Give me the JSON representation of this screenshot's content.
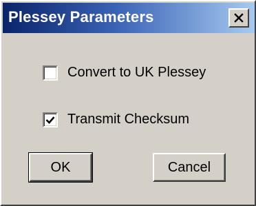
{
  "window": {
    "title": "Plessey Parameters",
    "close_icon": "close-icon"
  },
  "options": [
    {
      "label": "Convert to UK Plessey",
      "checked": false
    },
    {
      "label": "Transmit Checksum",
      "checked": true
    }
  ],
  "buttons": {
    "ok_label": "OK",
    "cancel_label": "Cancel"
  }
}
